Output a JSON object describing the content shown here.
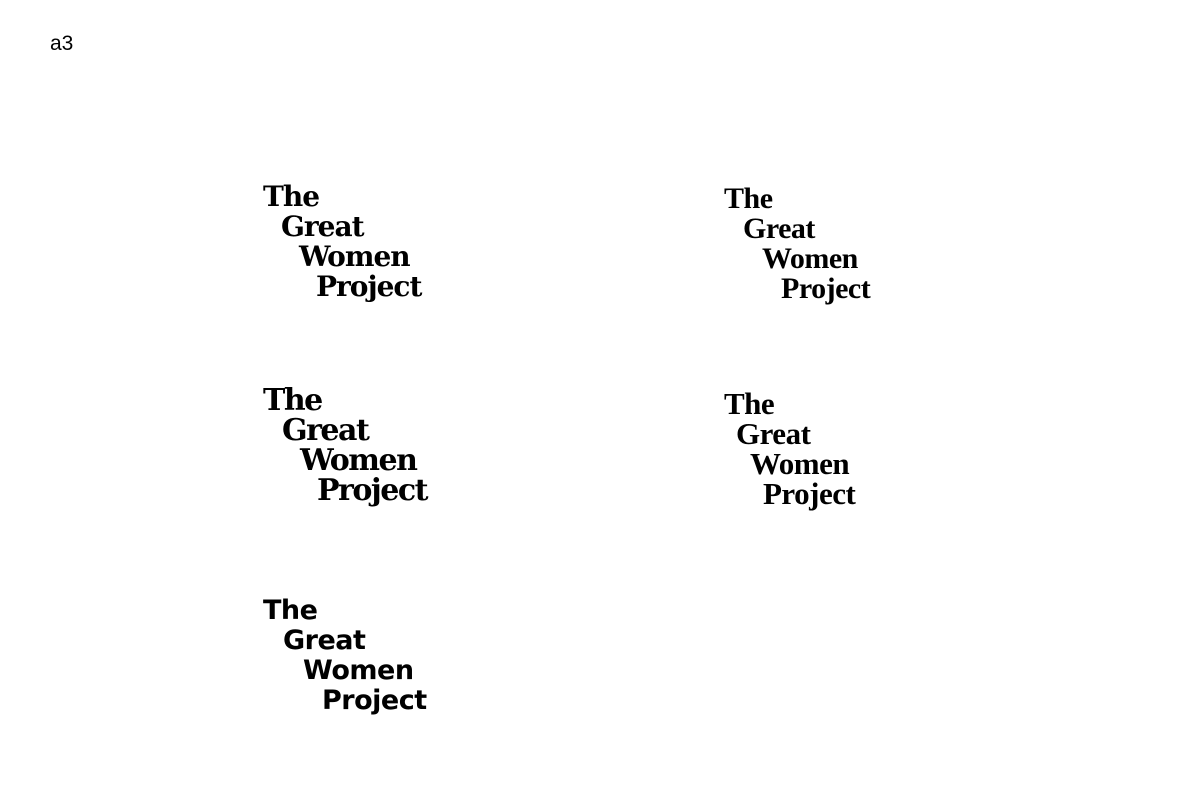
{
  "page": {
    "label": "a3"
  },
  "logos": [
    {
      "line1": "The",
      "line2": "Great",
      "line3": "Women",
      "line4": "Project"
    },
    {
      "line1": "The",
      "line2": "Great",
      "line3": "Women",
      "line4": "Project"
    },
    {
      "line1": "The",
      "line2": "Great",
      "line3": "Women",
      "line4": "Project"
    },
    {
      "line1": "The",
      "line2": "Great",
      "line3": "Women",
      "line4": "Project"
    },
    {
      "line1": "The",
      "line2": "Great",
      "line3": "Women",
      "line4": "Project"
    }
  ],
  "colors": {
    "background": "#ffffff",
    "text": "#000000"
  }
}
